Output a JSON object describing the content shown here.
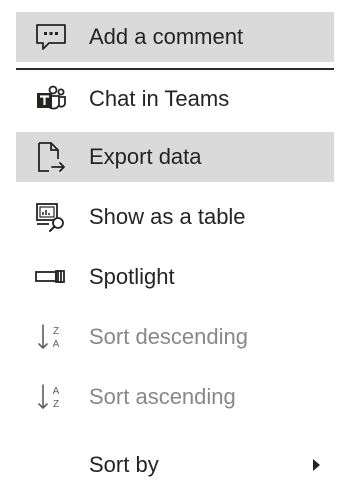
{
  "menu": {
    "items": [
      {
        "label": "Add a comment",
        "icon": "comment-icon"
      },
      {
        "label": "Chat in Teams",
        "icon": "teams-icon"
      },
      {
        "label": "Export data",
        "icon": "export-icon"
      },
      {
        "label": "Show as a table",
        "icon": "table-view-icon"
      },
      {
        "label": "Spotlight",
        "icon": "spotlight-icon"
      },
      {
        "label": "Sort descending",
        "icon": "sort-descending-icon"
      },
      {
        "label": "Sort ascending",
        "icon": "sort-ascending-icon"
      },
      {
        "label": "Sort by",
        "icon": "chevron-right-icon"
      }
    ]
  },
  "colors": {
    "highlight": "#dadada",
    "text": "#252423",
    "disabled_text": "#8a8886",
    "divider": "#2b2b2b"
  }
}
